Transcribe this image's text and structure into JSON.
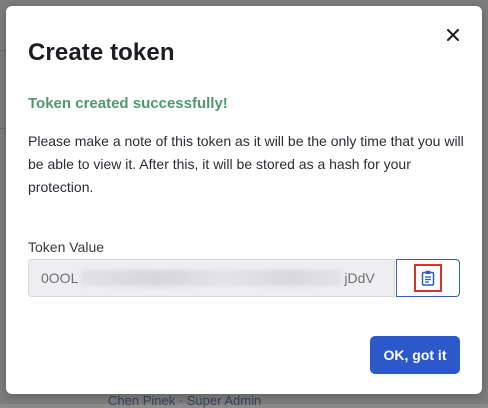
{
  "modal": {
    "title": "Create token",
    "success_message": "Token created successfully!",
    "note": "Please make a note of this token as it will be the only time that you will be able to view it. After this, it will be stored as a hash for your protection.",
    "token_label": "Token Value",
    "token_prefix": "0OOL",
    "token_suffix": "jDdV",
    "ok_button": "OK, got it",
    "icons": {
      "close": "close-icon",
      "copy": "clipboard-icon"
    }
  },
  "background": {
    "partial_text": "Chen Pinek · Super Admin"
  },
  "colors": {
    "success": "#4e9a6d",
    "primary": "#2c59c9",
    "copy_border": "#2f5fb6",
    "highlight": "#d2372f"
  }
}
